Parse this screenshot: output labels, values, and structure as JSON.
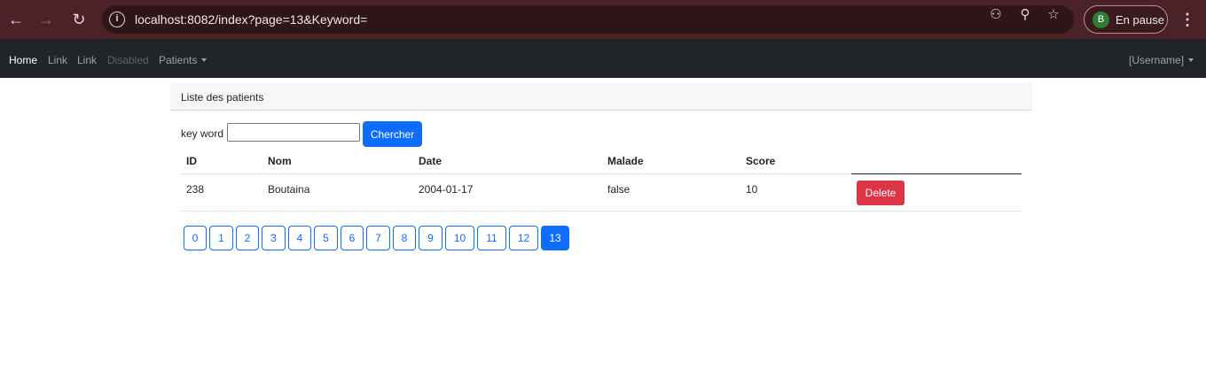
{
  "browser": {
    "url": "localhost:8082/index?page=13&Keyword=",
    "profile_initial": "B",
    "profile_label": "En pause"
  },
  "navbar": {
    "home": "Home",
    "link1": "Link",
    "link2": "Link",
    "disabled": "Disabled",
    "patients": "Patients",
    "user": "[Username]"
  },
  "card": {
    "header": "Liste des patients"
  },
  "search": {
    "label": "key word",
    "value": "",
    "button": "Chercher"
  },
  "table": {
    "columns": [
      "ID",
      "Nom",
      "Date",
      "Malade",
      "Score"
    ],
    "rows": [
      {
        "id": "238",
        "nom": "Boutaina",
        "date": "2004-01-17",
        "malade": "false",
        "score": "10",
        "action": "Delete"
      }
    ]
  },
  "pagination": {
    "pages": [
      "0",
      "1",
      "2",
      "3",
      "4",
      "5",
      "6",
      "7",
      "8",
      "9",
      "10",
      "11",
      "12",
      "13"
    ],
    "current": 13
  },
  "colors": {
    "primary": "#0d6efd",
    "danger": "#dc3545",
    "navbar": "#212529",
    "chrome": "#4a2228"
  }
}
